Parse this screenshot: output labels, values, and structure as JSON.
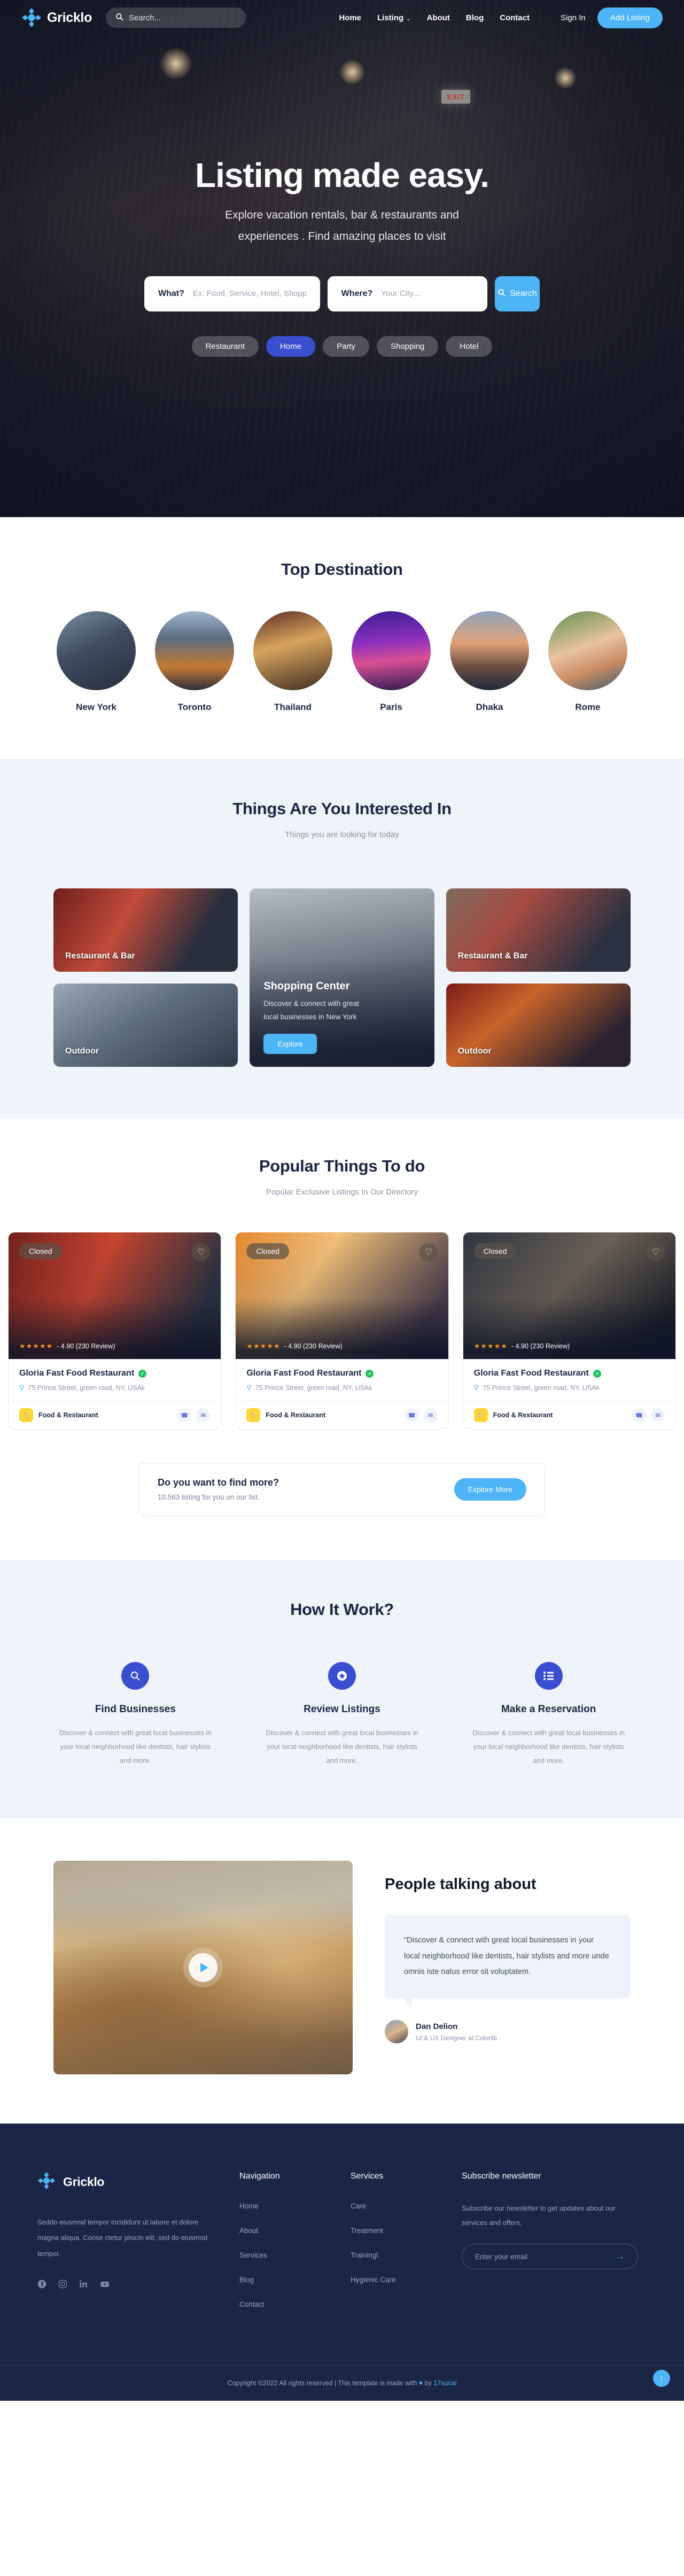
{
  "brand": {
    "name": "Gricklo"
  },
  "nav": {
    "search_placeholder": "Search...",
    "links": [
      {
        "label": "Home"
      },
      {
        "label": "Listing",
        "caret": "⌄"
      },
      {
        "label": "About"
      },
      {
        "label": "Blog"
      },
      {
        "label": "Contact"
      }
    ],
    "signin": "Sign In",
    "add_listing": "Add Listing"
  },
  "hero": {
    "title": "Listing made easy.",
    "subtitle_line1": "Explore vacation rentals, bar & restaurants and",
    "subtitle_line2": "experiences . Find amazing places to visit",
    "exit_sign": "EXIT",
    "search": {
      "what_label": "What?",
      "what_placeholder": "Ex: Food, Service, Hotel, Shopping",
      "where_label": "Where?",
      "where_placeholder": "Your City....",
      "button": "Search"
    },
    "pills": [
      {
        "label": "Restaurant",
        "active": false
      },
      {
        "label": "Home",
        "active": true
      },
      {
        "label": "Party",
        "active": false
      },
      {
        "label": "Shopping",
        "active": false
      },
      {
        "label": "Hotel",
        "active": false
      }
    ]
  },
  "destinations": {
    "title": "Top Destination",
    "items": [
      {
        "name": "New York"
      },
      {
        "name": "Toronto"
      },
      {
        "name": "Thailand"
      },
      {
        "name": "Paris"
      },
      {
        "name": "Dhaka"
      },
      {
        "name": "Rome"
      }
    ]
  },
  "interests": {
    "title": "Things Are You Interested In",
    "subtitle": "Things you are looking for today",
    "tiles": [
      {
        "label": "Restaurant & Bar"
      },
      {
        "label": "Outdoor"
      },
      {
        "label": "Restaurant & Bar"
      },
      {
        "label": "Outdoor"
      }
    ],
    "feature": {
      "title": "Shopping Center",
      "desc_line1": "Discover & connect with great",
      "desc_line2": "local businesses in New York",
      "button": "Explore"
    }
  },
  "popular": {
    "title": "Popular Things To do",
    "subtitle": "Popular Exclusive Listings In Our Directory",
    "prev": "‹",
    "next": "›",
    "cards": [
      {
        "badge": "Closed",
        "stars": "★★★★★",
        "rating": "- 4.90 (230 Review)",
        "title": "Gloria Fast Food Restaurant",
        "address": "75 Prince Street, green road, NY, USAk",
        "category": "Food & Restaurant",
        "cat_icon": "🍴",
        "phone_icon": "☎",
        "mail_icon": "✉"
      },
      {
        "badge": "Closed",
        "stars": "★★★★★",
        "rating": "- 4.90 (230 Review)",
        "title": "Gloria Fast Food Restaurant",
        "address": "75 Prince Street, green road, NY, USAk",
        "category": "Food & Restaurant",
        "cat_icon": "🍴",
        "phone_icon": "☎",
        "mail_icon": "✉"
      },
      {
        "badge": "Closed",
        "stars": "★★★★★",
        "rating": "- 4.90 (230 Review)",
        "title": "Gloria Fast Food Restaurant",
        "address": "75 Prince Street, green road, NY, USAk",
        "category": "Food & Restaurant",
        "cat_icon": "🍴",
        "phone_icon": "☎",
        "mail_icon": "✉"
      }
    ],
    "findmore": {
      "title": "Do you want to find more?",
      "subtitle": "10,563 listing for you on our list.",
      "button": "Explore More"
    }
  },
  "how": {
    "title": "How It Work?",
    "steps": [
      {
        "icon": "🔍",
        "title": "Find Businesses",
        "desc": "Discover & connect with great local businesses in your local neighborhood like dentists, hair stylists and more."
      },
      {
        "icon": "★",
        "title": "Review Listings",
        "desc": "Discover & connect with great local businesses in your local neighborhood like dentists, hair stylists and more."
      },
      {
        "icon": "≡",
        "title": "Make a Reservation",
        "desc": "Discover & connect with great local businesses in your local neighborhood like dentists, hair stylists and more."
      }
    ]
  },
  "talking": {
    "title": "People talking about",
    "quote": "\"Discover & connect with great local businesses in your local neighborhood like dentists, hair stylists and more unde omnis iste natus error sit voluptatem.",
    "author_name": "Dan Delion",
    "author_role": "UI & UX Designer at Colorlib"
  },
  "footer": {
    "desc": "Seddo eiusmod tempor incididunt ut labore et dolore magna aliqua. Conse ctetur pisicin elit, sed do eiusmod tempor.",
    "social": [
      {
        "icon": "f",
        "name": "facebook"
      },
      {
        "icon": "▢",
        "name": "instagram"
      },
      {
        "icon": "in",
        "name": "linkedin"
      },
      {
        "icon": "▶",
        "name": "youtube"
      }
    ],
    "navigation": {
      "heading": "Navigation",
      "items": [
        {
          "label": "Home"
        },
        {
          "label": "About"
        },
        {
          "label": "Services"
        },
        {
          "label": "Blog"
        },
        {
          "label": "Contact"
        }
      ]
    },
    "services": {
      "heading": "Services",
      "items": [
        {
          "label": "Care"
        },
        {
          "label": "Treatment"
        },
        {
          "label": "Trainingl"
        },
        {
          "label": "Hygienic Care"
        }
      ]
    },
    "newsletter": {
      "heading": "Subscribe newsletter",
      "desc": "Subscribe our newsletter to get updates about our services and offers.",
      "placeholder": "Enter your email",
      "arrow": "→"
    },
    "copyright_pre": "Copyright ©2022 All rights reserved | This template is made with ",
    "copyright_heart": "♥",
    "copyright_mid": " by ",
    "copyright_link": "17sucai",
    "fab": "↑"
  },
  "colors": {
    "accent": "#4cb4f7",
    "indigo": "#3a4ed0",
    "dark": "#1b2545",
    "star": "#f7941d",
    "verified": "#25c162"
  }
}
